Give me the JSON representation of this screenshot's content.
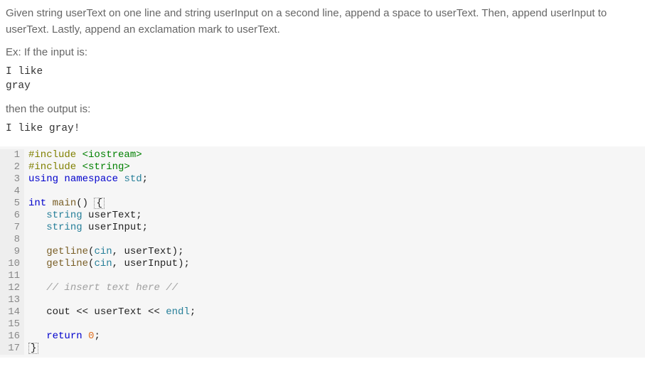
{
  "prompt": {
    "paragraph": "Given string userText on one line and string userInput on a second line, append a space to userText. Then, append userInput to userText. Lastly, append an exclamation mark to userText.",
    "ex_input_label": "Ex: If the input is:",
    "input_line1": "I like",
    "input_line2": "gray",
    "ex_output_label": "then the output is:",
    "output_line1": "I like gray!"
  },
  "code": {
    "lines": [
      {
        "n": 1,
        "tokens": [
          {
            "t": "#include",
            "c": "tok-pre"
          },
          {
            "t": " "
          },
          {
            "t": "<iostream>",
            "c": "tok-head"
          }
        ]
      },
      {
        "n": 2,
        "tokens": [
          {
            "t": "#include",
            "c": "tok-pre"
          },
          {
            "t": " "
          },
          {
            "t": "<string>",
            "c": "tok-head"
          }
        ]
      },
      {
        "n": 3,
        "tokens": [
          {
            "t": "using",
            "c": "tok-key"
          },
          {
            "t": " "
          },
          {
            "t": "namespace",
            "c": "tok-key"
          },
          {
            "t": " "
          },
          {
            "t": "std",
            "c": "tok-type"
          },
          {
            "t": ";"
          }
        ]
      },
      {
        "n": 4,
        "tokens": []
      },
      {
        "n": 5,
        "tokens": [
          {
            "t": "int",
            "c": "tok-key"
          },
          {
            "t": " "
          },
          {
            "t": "main",
            "c": "tok-func"
          },
          {
            "t": "() "
          },
          {
            "t": "{",
            "c": "cursor-box"
          }
        ]
      },
      {
        "n": 6,
        "tokens": [
          {
            "t": "   "
          },
          {
            "t": "string",
            "c": "tok-type"
          },
          {
            "t": " userText;"
          }
        ]
      },
      {
        "n": 7,
        "tokens": [
          {
            "t": "   "
          },
          {
            "t": "string",
            "c": "tok-type"
          },
          {
            "t": " userInput;"
          }
        ]
      },
      {
        "n": 8,
        "tokens": []
      },
      {
        "n": 9,
        "tokens": [
          {
            "t": "   "
          },
          {
            "t": "getline",
            "c": "tok-func"
          },
          {
            "t": "("
          },
          {
            "t": "cin",
            "c": "tok-type"
          },
          {
            "t": ", userText);"
          }
        ]
      },
      {
        "n": 10,
        "tokens": [
          {
            "t": "   "
          },
          {
            "t": "getline",
            "c": "tok-func"
          },
          {
            "t": "("
          },
          {
            "t": "cin",
            "c": "tok-type"
          },
          {
            "t": ", userInput);"
          }
        ]
      },
      {
        "n": 11,
        "tokens": []
      },
      {
        "n": 12,
        "tokens": [
          {
            "t": "   "
          },
          {
            "t": "// insert text here //",
            "c": "tok-comm"
          }
        ]
      },
      {
        "n": 13,
        "tokens": []
      },
      {
        "n": 14,
        "tokens": [
          {
            "t": "   cout << userText << "
          },
          {
            "t": "endl",
            "c": "tok-type"
          },
          {
            "t": ";"
          }
        ]
      },
      {
        "n": 15,
        "tokens": []
      },
      {
        "n": 16,
        "tokens": [
          {
            "t": "   "
          },
          {
            "t": "return",
            "c": "tok-key"
          },
          {
            "t": " "
          },
          {
            "t": "0",
            "c": "tok-num"
          },
          {
            "t": ";"
          }
        ]
      },
      {
        "n": 17,
        "tokens": [
          {
            "t": "}",
            "c": "cursor-box"
          }
        ]
      }
    ]
  }
}
